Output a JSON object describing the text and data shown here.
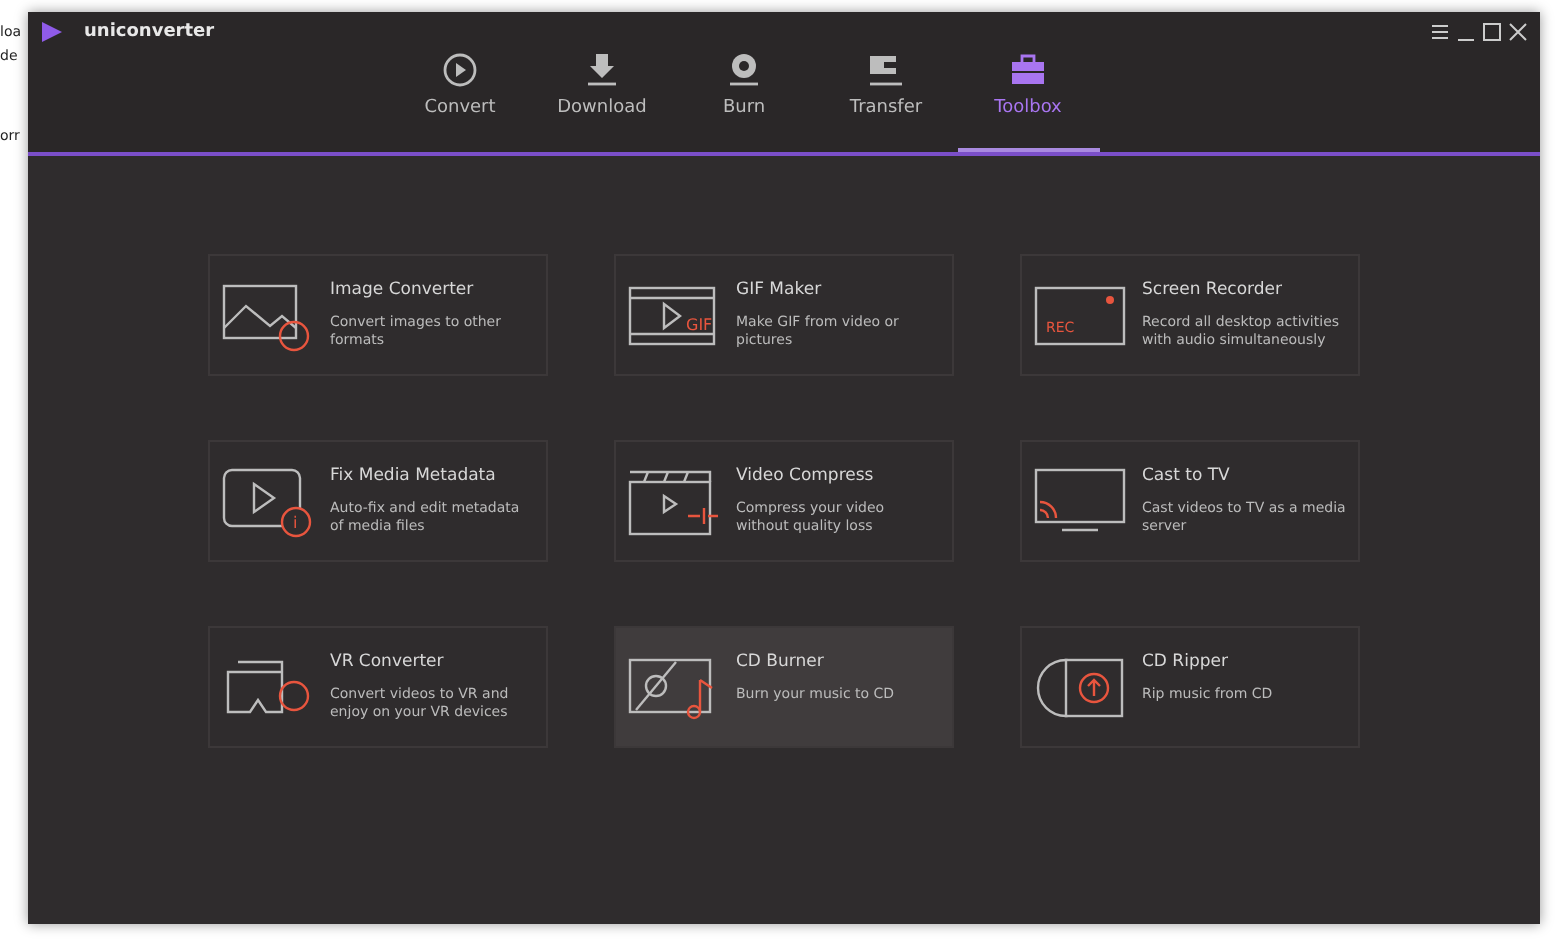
{
  "background_window": {
    "side_fragments": [
      "loa",
      "de",
      "orr"
    ]
  },
  "window": {
    "title": "uniconverter"
  },
  "tabs": [
    {
      "label": "Convert",
      "selected": false
    },
    {
      "label": "Download",
      "selected": false
    },
    {
      "label": "Burn",
      "selected": false
    },
    {
      "label": "Transfer",
      "selected": false
    },
    {
      "label": "Toolbox",
      "selected": true
    }
  ],
  "tools": [
    {
      "title": "Image Converter",
      "description": "Convert images to other formats",
      "highlighted": false
    },
    {
      "title": "GIF Maker",
      "description": "Make GIF from video or pictures",
      "icon_text": "GIF",
      "highlighted": false
    },
    {
      "title": "Screen Recorder",
      "description": "Record all desktop activities with audio simultaneously",
      "icon_text": "REC",
      "highlighted": false
    },
    {
      "title": "Fix Media Metadata",
      "description": "Auto-fix and edit metadata of media files",
      "icon_text": "i",
      "highlighted": false
    },
    {
      "title": "Video Compress",
      "description": "Compress your video without quality loss",
      "highlighted": false
    },
    {
      "title": "Cast to TV",
      "description": "Cast videos to TV as a media server",
      "highlighted": false
    },
    {
      "title": "VR Converter",
      "description": "Convert videos to VR and enjoy on your VR devices",
      "highlighted": false
    },
    {
      "title": "CD Burner",
      "description": "Burn your music to CD",
      "highlighted": true
    },
    {
      "title": "CD Ripper",
      "description": "Rip music from CD",
      "highlighted": false
    }
  ]
}
